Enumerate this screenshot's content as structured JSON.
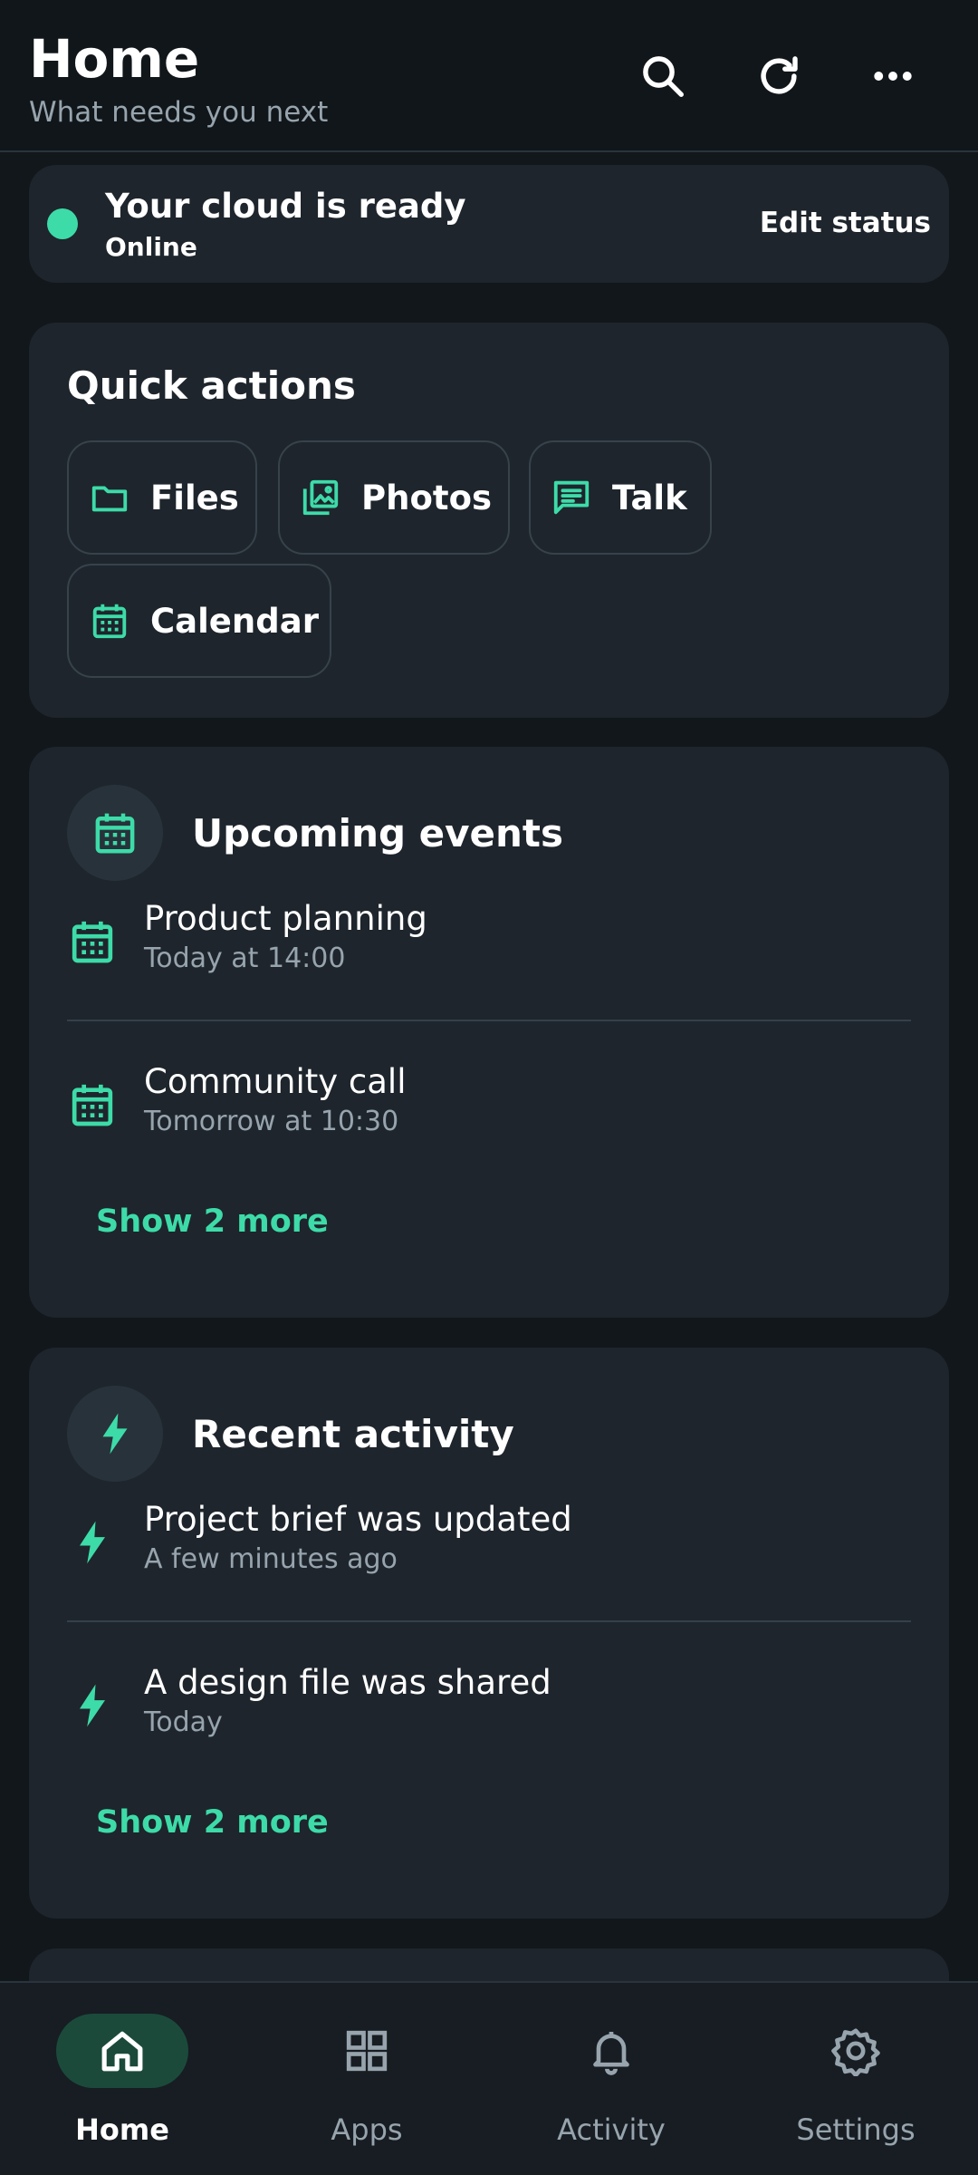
{
  "header": {
    "title": "Home",
    "subtitle": "What needs you next",
    "actions": [
      "search-icon",
      "refresh-icon",
      "more-icon"
    ]
  },
  "status": {
    "title": "Your cloud is ready",
    "state": "Online",
    "edit_label": "Edit status",
    "dot_color": "#3ddba8"
  },
  "quick_actions": {
    "heading": "Quick actions",
    "items": [
      {
        "label": "Files",
        "icon": "folder-icon"
      },
      {
        "label": "Photos",
        "icon": "photos-icon"
      },
      {
        "label": "Talk",
        "icon": "chat-icon"
      },
      {
        "label": "Calendar",
        "icon": "calendar-icon"
      }
    ]
  },
  "events": {
    "title": "Upcoming events",
    "items": [
      {
        "title": "Product planning",
        "time": "Today at 14:00"
      },
      {
        "title": "Community call",
        "time": "Tomorrow at 10:30"
      }
    ],
    "show_more": "Show 2 more"
  },
  "activity": {
    "title": "Recent activity",
    "items": [
      {
        "title": "Project brief was updated",
        "time": "A few minutes ago"
      },
      {
        "title": "A design file was shared",
        "time": "Today"
      }
    ],
    "show_more": "Show 2 more"
  },
  "nav": {
    "items": [
      {
        "label": "Home",
        "icon": "home-icon",
        "active": true
      },
      {
        "label": "Apps",
        "icon": "apps-icon",
        "active": false
      },
      {
        "label": "Activity",
        "icon": "bell-icon",
        "active": false
      },
      {
        "label": "Settings",
        "icon": "gear-icon",
        "active": false
      }
    ]
  },
  "colors": {
    "accent": "#3ddba8",
    "background": "#12171c",
    "card": "#1e252c",
    "nav_active_pill": "#1b4a3b"
  }
}
